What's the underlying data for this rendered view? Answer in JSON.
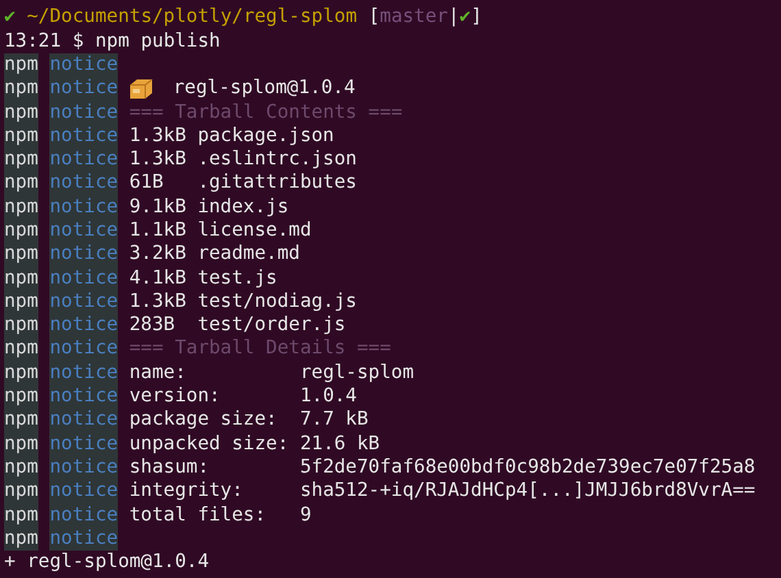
{
  "prompt": {
    "status_mark": "✔",
    "path": "~/Documents/plotly/regl-splom",
    "open": "[",
    "branch": "master",
    "separator": "|",
    "clean_mark": "✔",
    "close": "]"
  },
  "command": {
    "time": "13:21",
    "symbol": "$",
    "text": "npm publish"
  },
  "log": [
    {
      "kind": "blank",
      "source": "npm",
      "level": "notice"
    },
    {
      "kind": "package",
      "source": "npm",
      "level": "notice",
      "text": "regl-splom@1.0.4"
    },
    {
      "kind": "heading",
      "source": "npm",
      "level": "notice",
      "text": "=== Tarball Contents ==="
    },
    {
      "kind": "file",
      "source": "npm",
      "level": "notice",
      "size": "1.3kB",
      "file": "package.json"
    },
    {
      "kind": "file",
      "source": "npm",
      "level": "notice",
      "size": "1.3kB",
      "file": ".eslintrc.json"
    },
    {
      "kind": "file",
      "source": "npm",
      "level": "notice",
      "size": "61B",
      "file": ".gitattributes"
    },
    {
      "kind": "file",
      "source": "npm",
      "level": "notice",
      "size": "9.1kB",
      "file": "index.js"
    },
    {
      "kind": "file",
      "source": "npm",
      "level": "notice",
      "size": "1.1kB",
      "file": "license.md"
    },
    {
      "kind": "file",
      "source": "npm",
      "level": "notice",
      "size": "3.2kB",
      "file": "readme.md"
    },
    {
      "kind": "file",
      "source": "npm",
      "level": "notice",
      "size": "4.1kB",
      "file": "test.js"
    },
    {
      "kind": "file",
      "source": "npm",
      "level": "notice",
      "size": "1.3kB",
      "file": "test/nodiag.js"
    },
    {
      "kind": "file",
      "source": "npm",
      "level": "notice",
      "size": "283B",
      "file": "test/order.js"
    },
    {
      "kind": "heading",
      "source": "npm",
      "level": "notice",
      "text": "=== Tarball Details ==="
    },
    {
      "kind": "detail",
      "source": "npm",
      "level": "notice",
      "key": "name:",
      "value": "regl-splom"
    },
    {
      "kind": "detail",
      "source": "npm",
      "level": "notice",
      "key": "version:",
      "value": "1.0.4"
    },
    {
      "kind": "detail",
      "source": "npm",
      "level": "notice",
      "key": "package size:",
      "value": "7.7 kB"
    },
    {
      "kind": "detail",
      "source": "npm",
      "level": "notice",
      "key": "unpacked size:",
      "value": "21.6 kB"
    },
    {
      "kind": "detail",
      "source": "npm",
      "level": "notice",
      "key": "shasum:",
      "value": "5f2de70faf68e00bdf0c98b2de739ec7e07f25a8"
    },
    {
      "kind": "detail",
      "source": "npm",
      "level": "notice",
      "key": "integrity:",
      "value": "sha512-+iq/RJAJdHCp4[...]JMJJ6brd8VvrA=="
    },
    {
      "kind": "detail",
      "source": "npm",
      "level": "notice",
      "key": "total files:",
      "value": "9"
    },
    {
      "kind": "blank",
      "source": "npm",
      "level": "notice"
    }
  ],
  "result": "+ regl-splom@1.0.4"
}
